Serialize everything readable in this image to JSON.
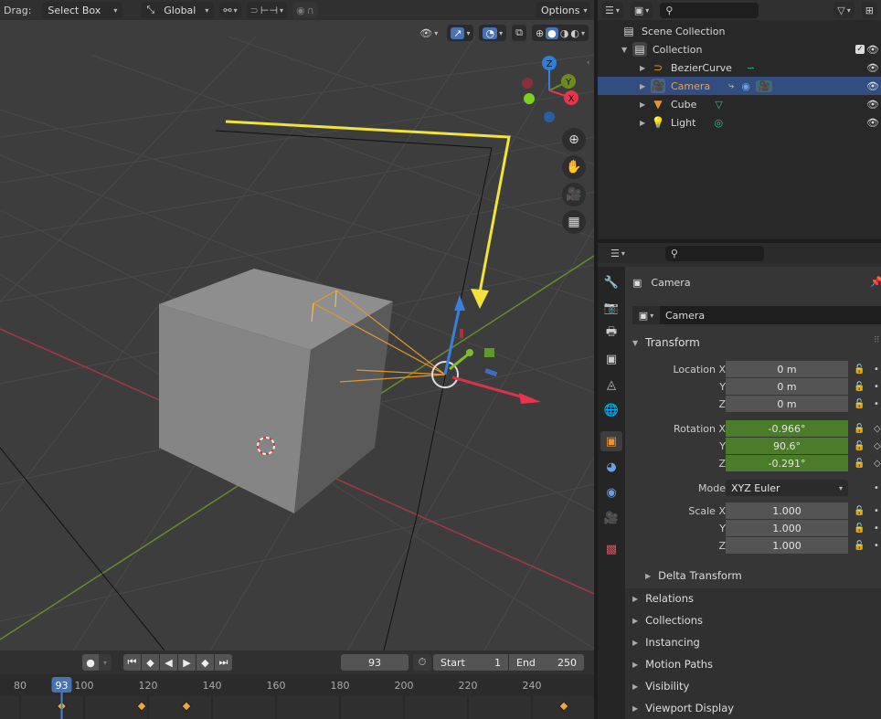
{
  "header": {
    "drag_label": "Drag:",
    "drag_mode": "Select Box",
    "orientation": "Global",
    "options_label": "Options"
  },
  "outliner": {
    "root": "Scene Collection",
    "collection": "Collection",
    "items": [
      {
        "name": "BezierCurve",
        "type": "curve",
        "selected": false
      },
      {
        "name": "Camera",
        "type": "camera",
        "selected": true
      },
      {
        "name": "Cube",
        "type": "mesh",
        "selected": false
      },
      {
        "name": "Light",
        "type": "light",
        "selected": false
      }
    ]
  },
  "properties": {
    "object_name": "Camera",
    "data_name": "Camera",
    "transform_label": "Transform",
    "location": {
      "label": "Location X",
      "x": "0 m",
      "y": "0 m",
      "z": "0 m"
    },
    "rotation": {
      "label": "Rotation X",
      "x": "-0.966°",
      "y": "90.6°",
      "z": "-0.291°"
    },
    "mode_label": "Mode",
    "mode_value": "XYZ Euler",
    "scale": {
      "label": "Scale X",
      "x": "1.000",
      "y": "1.000",
      "z": "1.000"
    },
    "axis_y": "Y",
    "axis_z": "Z",
    "delta_transform": "Delta Transform",
    "panels": [
      "Relations",
      "Collections",
      "Instancing",
      "Motion Paths",
      "Visibility",
      "Viewport Display"
    ],
    "colors": {
      "keyed": "#4b7c2a",
      "selected_row": "#334d80",
      "accent": "#4772b3"
    }
  },
  "timeline": {
    "current_frame": "93",
    "start_label": "Start",
    "start": "1",
    "end_label": "End",
    "end": "250",
    "ruler": [
      "80",
      "100",
      "120",
      "140",
      "160",
      "180",
      "200",
      "220",
      "240"
    ],
    "keyframes": [
      93,
      118,
      132,
      250
    ]
  },
  "gizmo": {
    "z": "Z",
    "y": "Y",
    "x": "X"
  }
}
